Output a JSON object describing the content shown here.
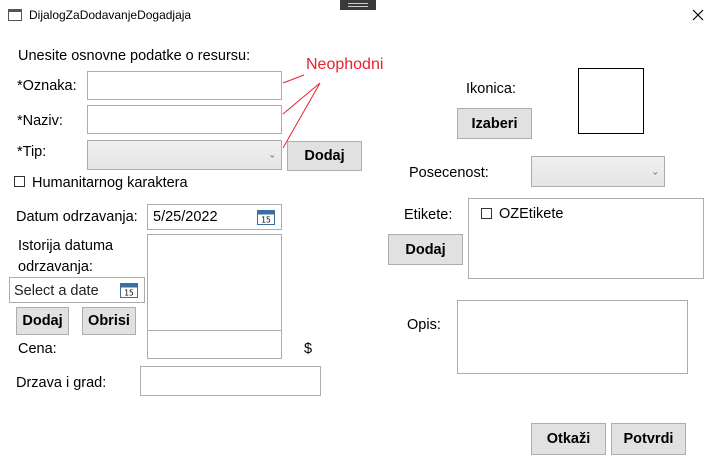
{
  "window": {
    "title": "DijalogZaDodavanjeDogadjaja"
  },
  "form": {
    "intro_label": "Unesite osnovne podatke o resursu:",
    "required_note": "Neophodni",
    "oznaka_label": "*Oznaka:",
    "oznaka_value": "",
    "naziv_label": "*Naziv:",
    "naziv_value": "",
    "tip_label": "*Tip:",
    "tip_value": "",
    "tip_add_button": "Dodaj",
    "humanitarian_label": "Humanitarnog karaktera",
    "datum_label": "Datum odrzavanja:",
    "datum_value": "5/25/2022",
    "calendar_day": "15",
    "istorija_label_line1": "Istorija datuma",
    "istorija_label_line2": "odrzavanja:",
    "select_date_placeholder": "Select a date",
    "history_add_button": "Dodaj",
    "history_remove_button": "Obrisi",
    "cena_label": "Cena:",
    "cena_value": "",
    "currency_symbol": "$",
    "drzava_label": "Drzava i grad:",
    "drzava_value": "",
    "ikonica_label": "Ikonica:",
    "izaberi_button": "Izaberi",
    "posecenost_label": "Posecenost:",
    "posecenost_value": "",
    "etikete_label": "Etikete:",
    "etikete_add_button": "Dodaj",
    "etikete_items": [
      "OZEtikete"
    ],
    "opis_label": "Opis:",
    "opis_value": ""
  },
  "footer": {
    "cancel_button": "Otkaži",
    "confirm_button": "Potvrdi"
  },
  "colors": {
    "required_note": "#e8232e",
    "button_bg": "#e1e1e1",
    "border": "#abadb3"
  }
}
